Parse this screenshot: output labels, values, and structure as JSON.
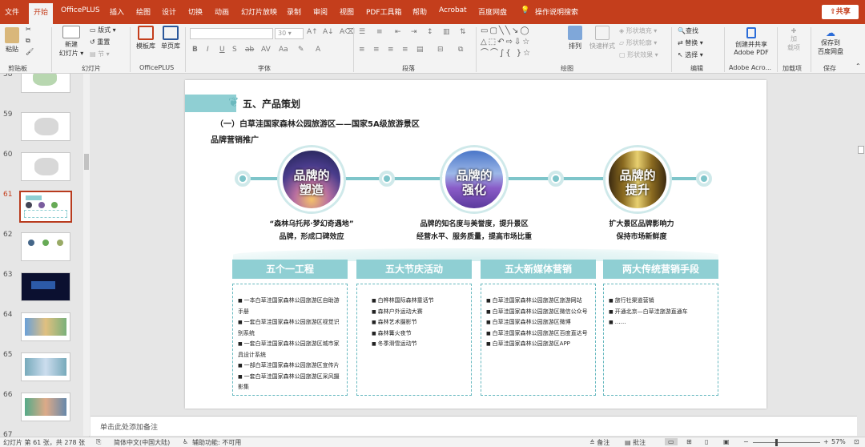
{
  "menubar": {
    "tabs": [
      "文件",
      "开始",
      "OfficePLUS",
      "插入",
      "绘图",
      "设计",
      "切换",
      "动画",
      "幻灯片放映",
      "录制",
      "审阅",
      "视图",
      "PDF工具箱",
      "帮助",
      "Acrobat",
      "百度网盘"
    ],
    "active_tab": "开始",
    "search_label": "操作说明搜索",
    "share_label": "共享",
    "accent": "#c43e1c"
  },
  "ribbon": {
    "clipboard": {
      "paste": "粘贴",
      "label": "剪贴板"
    },
    "slides": {
      "new_slide": "新建\n幻灯片",
      "layout": "版式",
      "reset": "重置",
      "section": "节",
      "label": "幻灯片"
    },
    "officeplus": {
      "template": "模板库",
      "single": "单页库",
      "label": "OfficePLUS"
    },
    "font": {
      "size": "30",
      "label": "字体"
    },
    "paragraph": {
      "label": "段落"
    },
    "drawing": {
      "arrange": "排列",
      "quick_styles": "快速样式",
      "fill": "形状填充",
      "outline": "形状轮廓",
      "effects": "形状效果",
      "label": "绘图"
    },
    "editing": {
      "find": "查找",
      "replace": "替换",
      "select": "选择",
      "label": "编辑"
    },
    "adobe": {
      "create_share": "创建并共享\nAdobe PDF",
      "label": "Adobe Acro..."
    },
    "addins": {
      "addin": "加\n载项",
      "label": "加载项"
    },
    "save": {
      "save_to": "保存到\n百度网盘",
      "label": "保存"
    }
  },
  "thumbnails": [
    {
      "num": "58"
    },
    {
      "num": "59"
    },
    {
      "num": "60"
    },
    {
      "num": "61",
      "selected": true
    },
    {
      "num": "62"
    },
    {
      "num": "63"
    },
    {
      "num": "64"
    },
    {
      "num": "65"
    },
    {
      "num": "66"
    },
    {
      "num": "67"
    }
  ],
  "slide": {
    "title": "五、产品策划",
    "subtitle": "（一）白草洼国家森林公园旅游区——国家5A级旅游景区",
    "section": "品牌营销推广",
    "stages": [
      {
        "label": "品牌的\n塑造",
        "caption": "“森林乌托邦·梦幻奇遇地”\n品牌，形成口碑效应"
      },
      {
        "label": "品牌的\n强化",
        "caption": "品牌的知名度与美誉度，提升景区\n经营水平、服务质量，提高市场比重"
      },
      {
        "label": "品牌的\n提升",
        "caption": "扩大景区品牌影响力\n保持市场新鲜度"
      }
    ],
    "columns": [
      {
        "head": "五个一工程",
        "items": [
          "一本白草洼国家森林公园旅游区自助游手册",
          "一套白草洼国家森林公园旅游区视觉识别系统",
          "一套白草洼国家森林公园旅游区城市家具设计系统",
          "一部白草洼国家森林公园旅游区宣传片",
          "一套白草洼国家森林公园旅游区采风摄影集"
        ]
      },
      {
        "head": "五大节庆活动",
        "items": [
          "白桦林国际森林童话节",
          "森林户外运动大赛",
          "森林艺术摄影节",
          "森林篝火夜节",
          "冬季滑雪运动节"
        ]
      },
      {
        "head": "五大新媒体营销",
        "items": [
          "白草洼国家森林公园旅游区旅游网站",
          "白草洼国家森林公园旅游区微信公众号",
          "白草洼国家森林公园旅游区微博",
          "白草洼国家森林公园旅游区百度直达号",
          "白草洼国家森林公园旅游区APP"
        ]
      },
      {
        "head": "两大传统营销手段",
        "items": [
          "旅行社渠道营销",
          "开通北京—白草洼旅游直通车",
          "……"
        ]
      }
    ]
  },
  "notes_placeholder": "单击此处添加备注",
  "status": {
    "slide_info": "幻灯片 第 61 张，共 278 张",
    "language": "简体中文(中国大陆)",
    "accessibility": "辅助功能: 不可用",
    "notes": "备注",
    "comments": "批注",
    "zoom": "57%"
  }
}
